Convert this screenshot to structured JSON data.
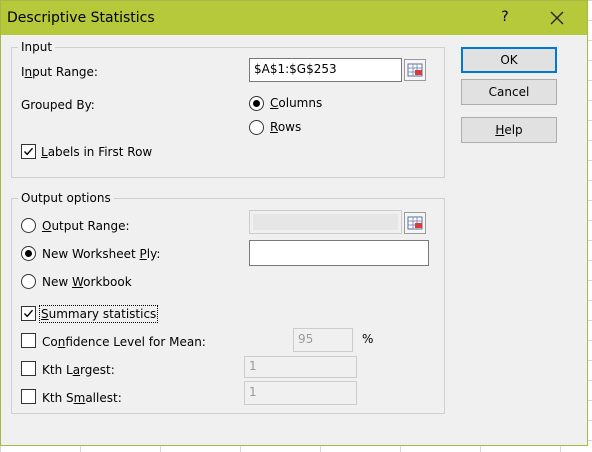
{
  "title": "Descriptive Statistics",
  "title_help": "?",
  "input": {
    "legend": "Input",
    "range_label": "Input Range:",
    "range_value": "$A$1:$G$253",
    "grouped_by_label": "Grouped By:",
    "columns_label": "Columns",
    "rows_label": "Rows",
    "labels_first_row": "Labels in First Row"
  },
  "output": {
    "legend": "Output options",
    "output_range": "Output Range:",
    "new_ply": "New Worksheet Ply:",
    "new_workbook": "New Workbook",
    "summary_stats": "Summary statistics",
    "confidence_label": "Confidence Level for Mean:",
    "confidence_value": "95",
    "percent": "%",
    "kth_largest": "Kth Largest:",
    "kth_largest_value": "1",
    "kth_smallest": "Kth Smallest:",
    "kth_smallest_value": "1"
  },
  "buttons": {
    "ok": "OK",
    "cancel": "Cancel",
    "help": "Help"
  },
  "colors": {
    "titlebar": "#b5c93a",
    "accent": "#0078d7"
  },
  "state": {
    "grouped_by": "Columns",
    "labels_first_row": true,
    "output_choice": "New Worksheet Ply",
    "summary_statistics": true,
    "confidence_level": false,
    "kth_largest": false,
    "kth_smallest": false
  }
}
